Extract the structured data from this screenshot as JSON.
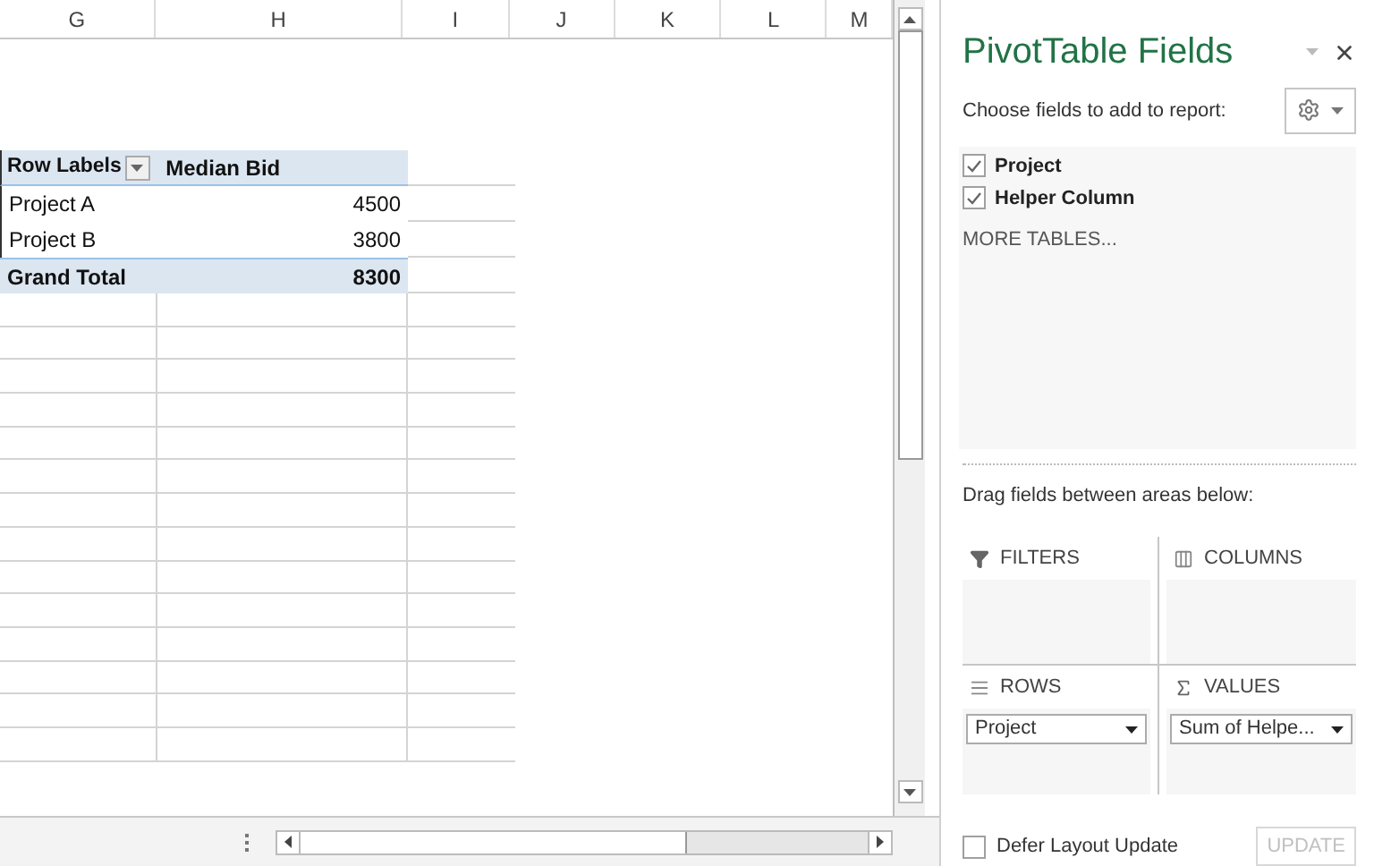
{
  "sheet": {
    "columns": [
      "G",
      "H",
      "I",
      "J",
      "K",
      "L",
      "M"
    ],
    "pivot": {
      "headers": [
        "Row Labels",
        "Median Bid"
      ],
      "rows": [
        {
          "label": "Project A",
          "value": "4500"
        },
        {
          "label": "Project B",
          "value": "3800"
        }
      ],
      "total": {
        "label": "Grand Total",
        "value": "8300"
      }
    }
  },
  "panel": {
    "title": "PivotTable Fields",
    "subtitle": "Choose fields to add to report:",
    "fields": [
      {
        "label": "Project",
        "checked": true
      },
      {
        "label": "Helper Column",
        "checked": true
      }
    ],
    "more_tables": "MORE TABLES...",
    "drag_hint": "Drag fields between areas below:",
    "areas": [
      {
        "kind": "filters",
        "label": "FILTERS"
      },
      {
        "kind": "columns",
        "label": "COLUMNS"
      },
      {
        "kind": "rows",
        "label": "ROWS",
        "items": [
          "Project"
        ]
      },
      {
        "kind": "values",
        "label": "VALUES",
        "items": [
          "Sum of Helpe..."
        ]
      }
    ],
    "defer": {
      "label": "Defer Layout Update",
      "checked": false
    },
    "update": {
      "label": "UPDATE",
      "disabled": true
    }
  }
}
